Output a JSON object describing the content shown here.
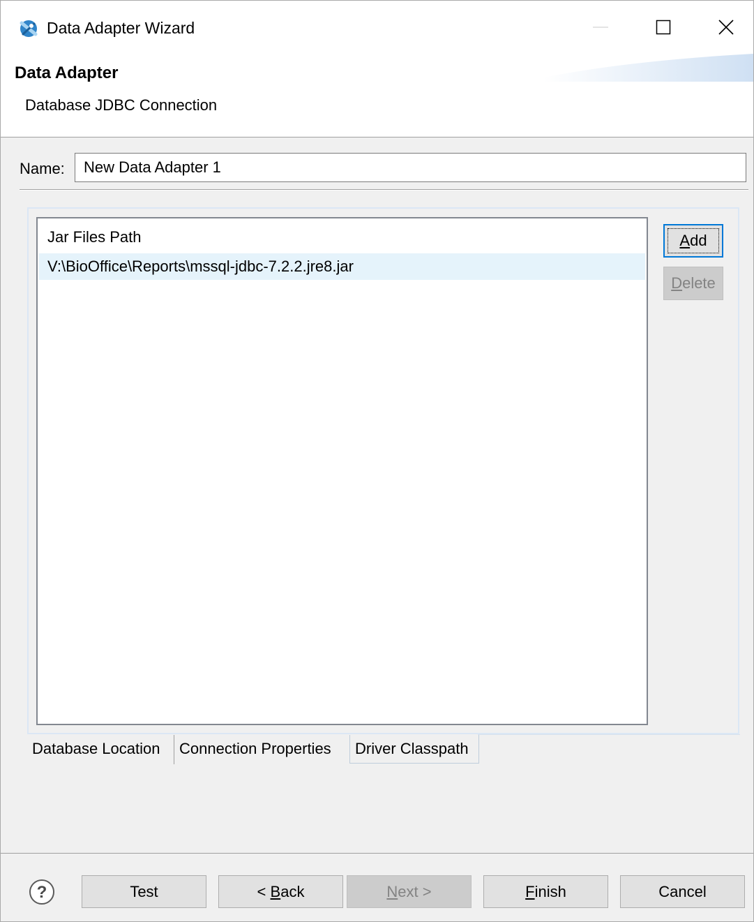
{
  "window": {
    "title": "Data Adapter Wizard"
  },
  "header": {
    "title": "Data Adapter",
    "subtitle": "Database JDBC Connection"
  },
  "name_field": {
    "label": "Name:",
    "value": "New Data Adapter 1"
  },
  "jar_table": {
    "column": "Jar Files Path",
    "rows": [
      "V:\\BioOffice\\Reports\\mssql-jdbc-7.2.2.jre8.jar"
    ]
  },
  "side_buttons": {
    "add": {
      "mnemonic": "A",
      "rest": "dd",
      "enabled": true
    },
    "delete": {
      "mnemonic": "D",
      "rest": "elete",
      "enabled": false
    }
  },
  "tabs": [
    {
      "label": "Database Location",
      "selected": false
    },
    {
      "label": "Connection Properties",
      "selected": false
    },
    {
      "label": "Driver Classpath",
      "selected": true
    }
  ],
  "footer": {
    "test": "Test",
    "back": {
      "prefix": "< ",
      "mnemonic": "B",
      "rest": "ack"
    },
    "next": {
      "mnemonic": "N",
      "rest": "ext >",
      "enabled": false
    },
    "finish": {
      "mnemonic": "F",
      "rest": "inish"
    },
    "cancel": "Cancel"
  },
  "colors": {
    "accent": "#0078d7",
    "selection": "#e5f3fb"
  },
  "icons": [
    "app-logo-icon",
    "minimize-icon",
    "maximize-icon",
    "close-icon",
    "help-icon"
  ]
}
